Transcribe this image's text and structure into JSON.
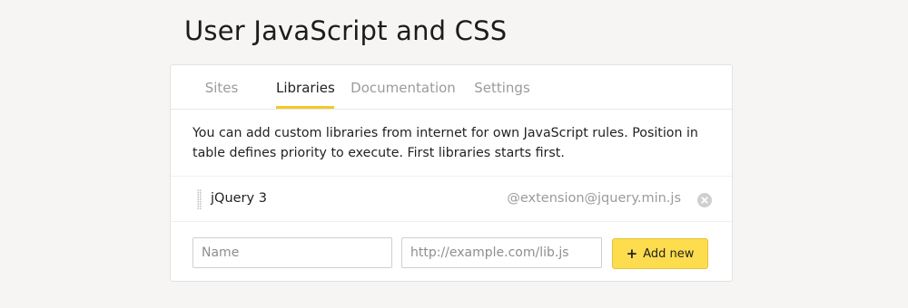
{
  "page": {
    "title": "User JavaScript and CSS"
  },
  "tabs": [
    {
      "label": "Sites",
      "active": false
    },
    {
      "label": "Libraries",
      "active": true
    },
    {
      "label": "Documentation",
      "active": false
    },
    {
      "label": "Settings",
      "active": false
    }
  ],
  "libraries": {
    "description": "You can add custom libraries from internet for own JavaScript rules. Position in table defines priority to execute. First libraries starts first.",
    "items": [
      {
        "name": "jQuery 3",
        "url": "@extension@jquery.min.js"
      }
    ],
    "form": {
      "name_placeholder": "Name",
      "name_value": "",
      "url_placeholder": "http://example.com/lib.js",
      "url_value": "",
      "add_label": "Add new",
      "add_icon": "plus-icon"
    }
  },
  "colors": {
    "accent": "#f2c926",
    "button": "#fddc4e",
    "background": "#f6f5f4"
  }
}
